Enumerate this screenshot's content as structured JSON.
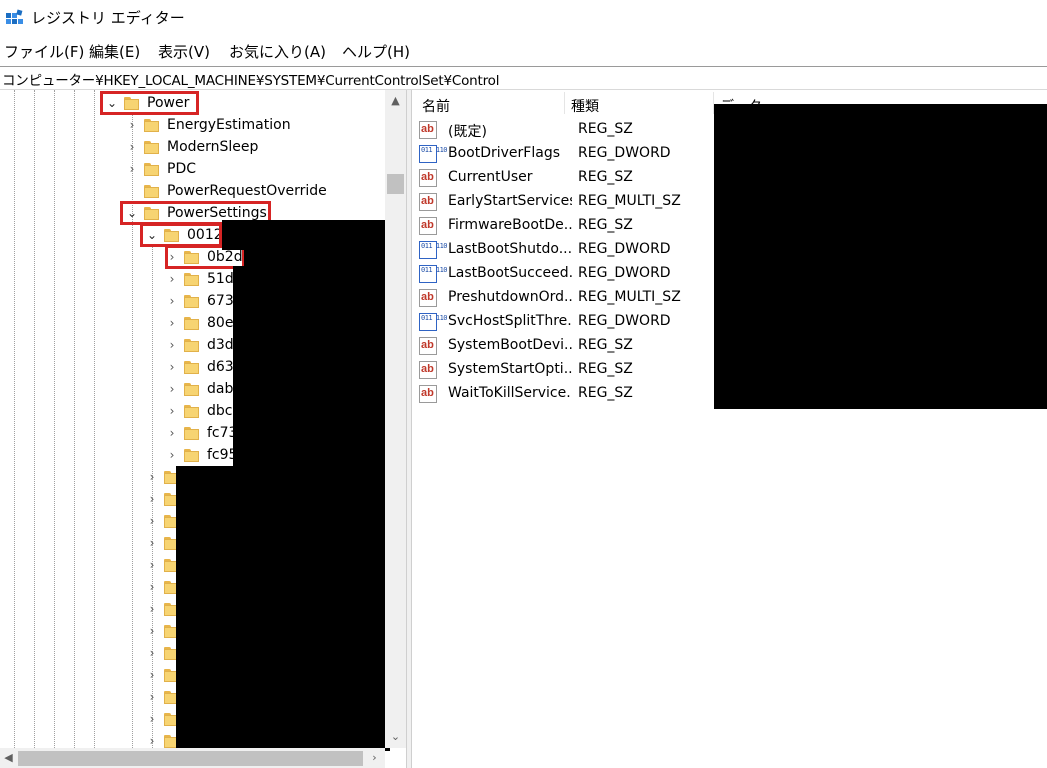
{
  "window": {
    "title": "レジストリ エディター",
    "icon": "registry-editor-icon"
  },
  "menu": [
    {
      "label": "ファイル(F)"
    },
    {
      "label": "編集(E)"
    },
    {
      "label": "表示(V)"
    },
    {
      "label": "お気に入り(A)"
    },
    {
      "label": "ヘルプ(H)"
    }
  ],
  "address": "コンピューター¥HKEY_LOCAL_MACHINE¥SYSTEM¥CurrentControlSet¥Control",
  "tree": {
    "items": [
      {
        "label": "Power",
        "expanded": true,
        "highlighted": true
      },
      {
        "label": "EnergyEstimation",
        "expanded": false
      },
      {
        "label": "ModernSleep",
        "expanded": false
      },
      {
        "label": "PDC",
        "expanded": false
      },
      {
        "label": "PowerRequestOverride",
        "expanded": false
      },
      {
        "label": "PowerSettings",
        "expanded": true,
        "highlighted": true
      },
      {
        "label": "0012",
        "expanded": true,
        "highlighted": true
      },
      {
        "label": "0b2d",
        "expanded": false,
        "highlighted": true
      },
      {
        "label": "51d"
      },
      {
        "label": "673"
      },
      {
        "label": "80e"
      },
      {
        "label": "d3d"
      },
      {
        "label": "d63"
      },
      {
        "label": "dab"
      },
      {
        "label": "dbc"
      },
      {
        "label": "fc73"
      },
      {
        "label": "fc95"
      }
    ]
  },
  "list": {
    "columns": {
      "name": "名前",
      "type": "種類",
      "data": "データ"
    },
    "rows": [
      {
        "name": "(既定)",
        "type": "REG_SZ",
        "icon": "string-value-icon"
      },
      {
        "name": "BootDriverFlags",
        "type": "REG_DWORD",
        "icon": "binary-value-icon"
      },
      {
        "name": "CurrentUser",
        "type": "REG_SZ",
        "icon": "string-value-icon"
      },
      {
        "name": "EarlyStartServices",
        "type": "REG_MULTI_SZ",
        "icon": "string-value-icon"
      },
      {
        "name": "FirmwareBootDe...",
        "type": "REG_SZ",
        "icon": "string-value-icon"
      },
      {
        "name": "LastBootShutdo...",
        "type": "REG_DWORD",
        "icon": "binary-value-icon"
      },
      {
        "name": "LastBootSucceed...",
        "type": "REG_DWORD",
        "icon": "binary-value-icon"
      },
      {
        "name": "PreshutdownOrd...",
        "type": "REG_MULTI_SZ",
        "icon": "string-value-icon"
      },
      {
        "name": "SvcHostSplitThre...",
        "type": "REG_DWORD",
        "icon": "binary-value-icon"
      },
      {
        "name": "SystemBootDevi...",
        "type": "REG_SZ",
        "icon": "string-value-icon"
      },
      {
        "name": "SystemStartOpti...",
        "type": "REG_SZ",
        "icon": "string-value-icon"
      },
      {
        "name": "WaitToKillService...",
        "type": "REG_SZ",
        "icon": "string-value-icon"
      }
    ]
  },
  "icons": {
    "string_glyph": "ab",
    "binary_glyph": "011 110"
  },
  "colors": {
    "highlight": "#d62424",
    "redaction": "#000000"
  }
}
